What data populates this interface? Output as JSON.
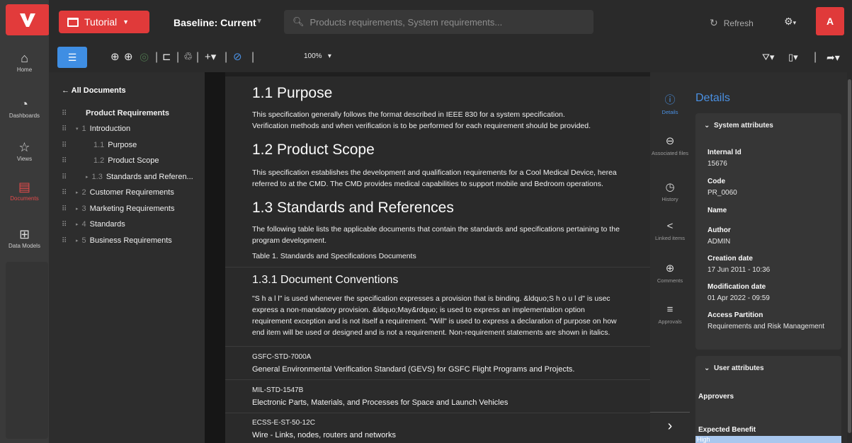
{
  "header": {
    "project_button": "Tutorial",
    "baseline": "Baseline: Current",
    "search_placeholder": "Products requirements, System requirements...",
    "refresh": "Refresh",
    "avatar_letter": "A"
  },
  "nav": {
    "items": [
      {
        "label": "Home",
        "icon": "home-icon"
      },
      {
        "label": "Dashboards",
        "icon": "dashboard-icon"
      },
      {
        "label": "Views",
        "icon": "star-icon"
      },
      {
        "label": "Documents",
        "icon": "document-icon"
      },
      {
        "label": "Data Models",
        "icon": "data-model-icon"
      }
    ],
    "active": "Documents",
    "accent": "#e23b3b"
  },
  "toolbar": {
    "zoom": "100%"
  },
  "tree": {
    "back_label": "← All Documents",
    "rows": [
      {
        "num": "",
        "label": "Product Requirements",
        "indent": 0,
        "toggle": ""
      },
      {
        "num": "1",
        "label": "Introduction",
        "indent": 1,
        "toggle": "▾"
      },
      {
        "num": "1.1",
        "label": "Purpose",
        "indent": 2,
        "toggle": ""
      },
      {
        "num": "1.2",
        "label": "Product Scope",
        "indent": 2,
        "toggle": ""
      },
      {
        "num": "1.3",
        "label": "Standards and Referen...",
        "indent": 2,
        "toggle": "▸"
      },
      {
        "num": "2",
        "label": "Customer Requirements",
        "indent": 1,
        "toggle": "▸"
      },
      {
        "num": "3",
        "label": "Marketing Requirements",
        "indent": 1,
        "toggle": "▸"
      },
      {
        "num": "4",
        "label": "Standards",
        "indent": 1,
        "toggle": "▸"
      },
      {
        "num": "5",
        "label": "Business Requirements",
        "indent": 1,
        "toggle": "▸"
      }
    ]
  },
  "doc": {
    "s11_title": "1.1  Purpose",
    "s11_line1": "This specification generally follows the format described in IEEE 830 for a system specification.",
    "s11_line2": "Verification methods and when verification is to be performed for each requirement should be provided.",
    "s12_title": "1.2  Product Scope",
    "s12_line1": "This specification establishes the development and qualification requirements for a Cool Medical Device, herea",
    "s12_line2": "referred to at the CMD.  The CMD provides medical capabilities to support mobile and Bedroom operations.",
    "s13_title": "1.3  Standards and References",
    "s13_line1": "The following table lists the applicable documents that contain the standards and specifications pertaining to the",
    "s13_line2": "program development.",
    "s13_table": "Table 1. Standards and Specifications Documents",
    "s131_title": "1.3.1  Document Conventions",
    "s131_line1": "\"S h a l l\" is used whenever the specification expresses a provision that is binding. &ldquo;S h o u l d\" is usec",
    "s131_line2": "express  a  non-mandatory  provision.  &ldquo;May&rdquo;  is  used  to  express  an  implementation  option",
    "s131_line3": "requirement exception and is not itself a requirement.  \"Will\" is used to express a declaration of purpose on how",
    "s131_line4": "end item will be used or designed and is not a requirement.  Non-requirement statements are shown in italics.",
    "refs": [
      {
        "code": "GSFC-STD-7000A",
        "title": "General Environmental Verification Standard (GEVS) for GSFC Flight Programs and Projects."
      },
      {
        "code": "MIL-STD-1547B",
        "title": "Electronic Parts, Materials, and Processes for Space and Launch Vehicles"
      },
      {
        "code": "ECSS-E-ST-50-12C",
        "title": "Wire - Links, nodes, routers and networks"
      }
    ]
  },
  "tabs": [
    {
      "label": "Details",
      "icon": "info-icon"
    },
    {
      "label": "Associated files",
      "icon": "attachment-icon"
    },
    {
      "label": "History",
      "icon": "history-icon"
    },
    {
      "label": "Linked items",
      "icon": "share-icon"
    },
    {
      "label": "Comments",
      "icon": "comment-icon"
    },
    {
      "label": "Approvals",
      "icon": "approvals-icon"
    }
  ],
  "details": {
    "title": "Details",
    "system_header": "System attributes",
    "internal_id_label": "Internal Id",
    "internal_id": "15676",
    "code_label": "Code",
    "code": "PR_0060",
    "name_label": "Name",
    "author_label": "Author",
    "author": "ADMIN",
    "creation_label": "Creation date",
    "creation": "17 Jun 2011 - 10:36",
    "modification_label": "Modification date",
    "modification": "01 Apr 2022 - 09:59",
    "access_label": "Access Partition",
    "access": "Requirements and Risk Management",
    "user_header": "User attributes",
    "approvers_label": "Approvers",
    "benefit_label": "Expected Benefit",
    "benefit": "High"
  }
}
